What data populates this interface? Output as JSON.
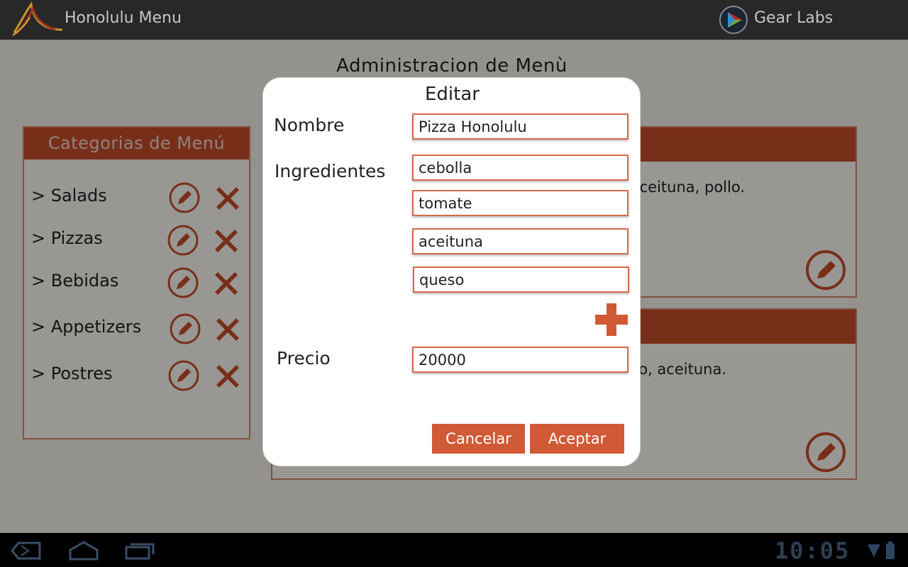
{
  "app": {
    "title": "Honolulu Menu",
    "partner": "Gear Labs"
  },
  "page": {
    "title": "Administracion de Menù"
  },
  "categories": {
    "header": "Categorias de Menú",
    "items": [
      {
        "label": "> Salads"
      },
      {
        "label": "> Pizzas"
      },
      {
        "label": "> Bebidas"
      },
      {
        "label": "> Appetizers"
      },
      {
        "label": "> Postres"
      }
    ],
    "edit_icon": "pencil-circle-icon",
    "delete_icon": "x-icon"
  },
  "cards": [
    {
      "description": "aceituna, pollo."
    },
    {
      "description": "o, aceituna."
    }
  ],
  "dialog": {
    "title": "Editar",
    "name_label": "Nombre",
    "name_value": "Pizza Honolulu",
    "ingredients_label": "Ingredientes",
    "ingredients": [
      "cebolla",
      "tomate",
      "aceituna",
      "queso"
    ],
    "price_label": "Precio",
    "price_value": "20000",
    "cancel_label": "Cancelar",
    "accept_label": "Aceptar"
  },
  "status": {
    "clock": "10:05"
  },
  "colors": {
    "accent": "#c84f2b",
    "button": "#d05a36",
    "topbar": "#282828",
    "background": "#f6f3e9"
  }
}
